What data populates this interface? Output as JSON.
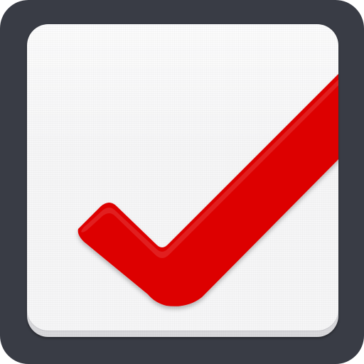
{
  "icon": {
    "name": "checkmark-icon",
    "state": "checked"
  },
  "colors": {
    "frame": "#393c45",
    "face": "#f6f6f7",
    "check": "#dd0000",
    "check_shadow": "#9e0000"
  }
}
